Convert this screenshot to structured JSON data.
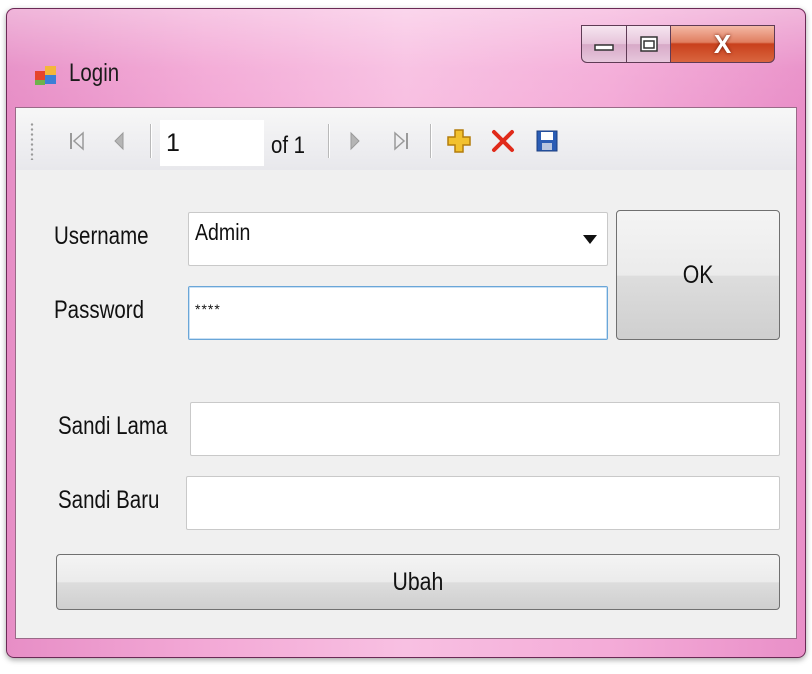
{
  "window": {
    "title": "Login",
    "close_glyph": "X"
  },
  "navigator": {
    "position": "1",
    "count_label": "of 1",
    "icons": [
      "move-first-icon",
      "move-previous-icon",
      "move-next-icon",
      "move-last-icon",
      "add-icon",
      "delete-icon",
      "save-icon"
    ]
  },
  "form": {
    "username_label": "Username",
    "username_value": "Admin",
    "password_label": "Password",
    "password_value": "****",
    "ok_label": "OK",
    "old_password_label": "Sandi Lama",
    "old_password_value": "",
    "new_password_label": "Sandi Baru",
    "new_password_value": "",
    "change_label": "Ubah"
  },
  "colors": {
    "frame": "#f3a9d6",
    "add_icon": "#f2c12e",
    "delete_icon": "#e02a1a",
    "save_icon": "#2b5db5",
    "focus_border": "#6aa6d8"
  }
}
